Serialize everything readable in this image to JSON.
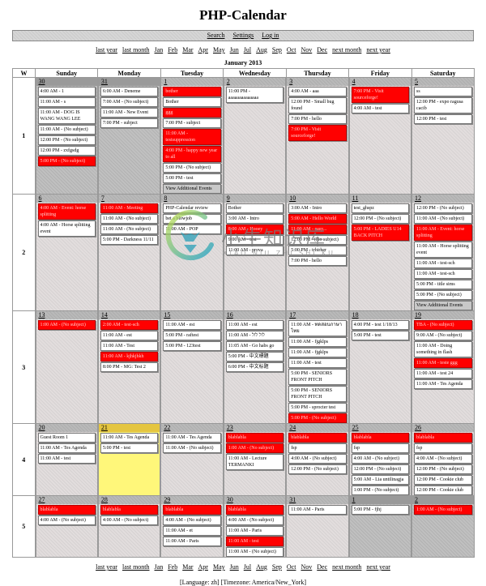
{
  "app": {
    "title": "PHP-Calendar"
  },
  "navbar": {
    "search": "Search",
    "settings": "Settings",
    "login": "Log in"
  },
  "month_nav": {
    "last_year": "last year",
    "last_month": "last month",
    "months": [
      "Jan",
      "Feb",
      "Mar",
      "Apr",
      "May",
      "Jun",
      "Jul",
      "Aug",
      "Sep",
      "Oct",
      "Nov",
      "Dec"
    ],
    "next_month": "next month",
    "next_year": "next year"
  },
  "calendar": {
    "caption": "January 2013",
    "week_header": "W",
    "weekdays": [
      "Sunday",
      "Monday",
      "Tuesday",
      "Wednesday",
      "Thursday",
      "Friday",
      "Saturday"
    ],
    "weeks": [
      {
        "number": "1",
        "days": [
          {
            "day": "30",
            "other": true,
            "events": [
              {
                "text": "4:00 AM - 1"
              },
              {
                "text": "11:00 AM - s"
              },
              {
                "text": "11:00 AM - DOG IS WANG WANG LEE"
              },
              {
                "text": "11:00 AM - (No subject)"
              },
              {
                "text": "12:00 PM - (No subject)"
              },
              {
                "text": "12:00 PM - zxfgsdg"
              },
              {
                "text": "5:00 PM - (No subject)",
                "highlight": true
              }
            ]
          },
          {
            "day": "31",
            "other": true,
            "events": [
              {
                "text": "6:00 AM - Deneme"
              },
              {
                "text": "7:00 AM - (No subject)"
              },
              {
                "text": "11:00 AM - New Event"
              },
              {
                "text": "7:00 PM - subject"
              }
            ]
          },
          {
            "day": "1",
            "events": [
              {
                "text": "bother",
                "highlight": true
              },
              {
                "text": "Bother"
              },
              {
                "text": "ggg",
                "highlight": true
              },
              {
                "text": "7:00 PM - subject"
              },
              {
                "text": "11:00 AM - testsuppression",
                "highlight": true
              },
              {
                "text": "4:00 PM - happy new year to all",
                "highlight": true
              },
              {
                "text": "5:00 PM - (No subject)"
              },
              {
                "text": "5:00 PM - test"
              },
              {
                "text": "View Additional Events",
                "more": true
              }
            ]
          },
          {
            "day": "2",
            "events": [
              {
                "text": "11:00 PM - aaaaaaaaaaaaaa"
              }
            ]
          },
          {
            "day": "3",
            "events": [
              {
                "text": "4:00 AM - aaa"
              },
              {
                "text": "12:00 PM - Small bug found"
              },
              {
                "text": "7:00 PM - hello"
              },
              {
                "text": "7:00 PM - Visit sourceforge!",
                "highlight": true
              }
            ]
          },
          {
            "day": "4",
            "events": [
              {
                "text": "7:00 PM - Visit sourceforge!",
                "highlight": true
              },
              {
                "text": "4:00 AM - test"
              }
            ]
          },
          {
            "day": "5",
            "events": [
              {
                "text": "ss"
              },
              {
                "text": "12:00 PM - expo ragusa cacib"
              },
              {
                "text": "12:00 PM - test"
              }
            ]
          }
        ]
      },
      {
        "number": "2",
        "days": [
          {
            "day": "6",
            "events": [
              {
                "text": "4:00 AM - Event: horse splitting",
                "highlight": true
              },
              {
                "text": "4:00 AM - Horse splitting event"
              }
            ]
          },
          {
            "day": "7",
            "events": [
              {
                "text": "11:00 AM - Meeting",
                "highlight": true
              },
              {
                "text": "11:00 AM - (No subject)"
              },
              {
                "text": "11:00 AM - (No subject)"
              },
              {
                "text": "5:00 PM - Darkness 11/11"
              }
            ]
          },
          {
            "day": "8",
            "events": [
              {
                "text": "PHP-Calendar review"
              },
              {
                "text": "bet a blowjob"
              },
              {
                "text": "11:00 AM - POP"
              }
            ]
          },
          {
            "day": "9",
            "events": [
              {
                "text": "Bother"
              },
              {
                "text": "3:00 AM - Intro"
              },
              {
                "text": "8:00 AM - Hooey",
                "highlight": true
              },
              {
                "text": "9:00 AM - test"
              },
              {
                "text": "11:00 AM - prova"
              }
            ]
          },
          {
            "day": "10",
            "events": [
              {
                "text": "3:00 AM - Intro"
              },
              {
                "text": "5:00 AM - Hello World",
                "highlight": true
              },
              {
                "text": "11:00 AM - easy...",
                "highlight": true
              },
              {
                "text": "12:00 PM - (No subject)"
              },
              {
                "text": "5:00 PM - trhtrher"
              },
              {
                "text": "7:00 PM - hello"
              }
            ]
          },
          {
            "day": "11",
            "events": [
              {
                "text": "test_ghspz"
              },
              {
                "text": "12:00 PM - (No subject)"
              },
              {
                "text": "5:00 PM - LADIES U14 BACK PITCH",
                "highlight": true
              }
            ]
          },
          {
            "day": "12",
            "events": [
              {
                "text": "12:00 PM - (No subject)"
              },
              {
                "text": "11:00 AM - (No subject)"
              },
              {
                "text": "11:00 AM - Event: horse splitting",
                "highlight": true
              },
              {
                "text": "11:00 AM - Horse splitting event"
              },
              {
                "text": "11:00 AM - test-sch"
              },
              {
                "text": "11:00 AM - test-sch"
              },
              {
                "text": "5:00 PM - title sims"
              },
              {
                "text": "5:00 PM - (No subject)"
              },
              {
                "text": "View Additional Events",
                "more": true
              }
            ]
          }
        ]
      },
      {
        "number": "3",
        "days": [
          {
            "day": "13",
            "events": [
              {
                "text": "1:00 AM - (No subject)",
                "highlight": true
              }
            ]
          },
          {
            "day": "14",
            "events": [
              {
                "text": "2:00 AM - test-sch",
                "highlight": true
              },
              {
                "text": "11:00 AM - est"
              },
              {
                "text": "11:00 AM - Test"
              },
              {
                "text": "11:00 AM - kjhkjhkh",
                "highlight": true
              },
              {
                "text": "8:00 PM - MG: Test 2"
              }
            ]
          },
          {
            "day": "15",
            "events": [
              {
                "text": "11:00 AM - est"
              },
              {
                "text": "5:00 PM - raftest"
              },
              {
                "text": "5:00 PM - 123test"
              }
            ]
          },
          {
            "day": "16",
            "events": [
              {
                "text": "11:00 AM - est"
              },
              {
                "text": "11:00 AM - לול לול"
              },
              {
                "text": "11:05 AM - Go habs go"
              },
              {
                "text": "5:00 PM - 中文標題"
              },
              {
                "text": "6:00 PM - 中文标题"
              }
            ]
          },
          {
            "day": "17",
            "events": [
              {
                "text": "11:00 AM - ทดสอบภาษาไทย"
              },
              {
                "text": "11:00 AM - fjgklps"
              },
              {
                "text": "11:00 AM - fjgklps"
              },
              {
                "text": "11:00 AM - test"
              },
              {
                "text": "5:00 PM - SENIORS FRONT PITCH"
              },
              {
                "text": "5:00 PM - SENIORS FRONT PITCH"
              },
              {
                "text": "5:00 PM - sprocter test"
              },
              {
                "text": "5:00 PM - (No subject)",
                "highlight": true
              }
            ]
          },
          {
            "day": "18",
            "events": [
              {
                "text": "4:00 PM - test 1/18/13"
              },
              {
                "text": "5:00 PM - test"
              }
            ]
          },
          {
            "day": "19",
            "events": [
              {
                "text": "TBA - (No subject)",
                "highlight": true
              },
              {
                "text": "9:00 AM - (No subject)"
              },
              {
                "text": "11:00 AM - Doing something in flash"
              },
              {
                "text": "11:00 AM - teste ggg",
                "highlight": true
              },
              {
                "text": "11:00 AM - test 24"
              },
              {
                "text": "11:00 AM - Tes Agenda"
              }
            ]
          }
        ]
      },
      {
        "number": "4",
        "days": [
          {
            "day": "20",
            "events": [
              {
                "text": "Guest Room 1"
              },
              {
                "text": "11:00 AM - Tes Agenda"
              },
              {
                "text": "11:00 AM - test"
              }
            ]
          },
          {
            "day": "21",
            "today": true,
            "events": [
              {
                "text": "11:00 AM - Tes Agenda"
              },
              {
                "text": "5:00 PM - test"
              }
            ]
          },
          {
            "day": "22",
            "events": [
              {
                "text": "11:00 AM - Tes Agenda"
              },
              {
                "text": "11:00 AM - (No subject)"
              }
            ]
          },
          {
            "day": "23",
            "events": [
              {
                "text": "blablabla",
                "highlight": true
              },
              {
                "text": "1:00 AM - (No subject)",
                "highlight": true
              },
              {
                "text": "11:00 AM - Lecture TERMANKI"
              }
            ]
          },
          {
            "day": "24",
            "events": [
              {
                "text": "blablabla",
                "highlight": true
              },
              {
                "text": "fsp"
              },
              {
                "text": "4:00 AM - (No subject)"
              },
              {
                "text": "12:00 PM - (No subject)"
              }
            ]
          },
          {
            "day": "25",
            "events": [
              {
                "text": "blablabla",
                "highlight": true
              },
              {
                "text": "fsp"
              },
              {
                "text": "4:00 AM - (No subject)"
              },
              {
                "text": "12:00 PM - (No subject)"
              },
              {
                "text": "5:00 AM - Lia untilinagja"
              },
              {
                "text": "1:00 PM - (No subject)"
              }
            ]
          },
          {
            "day": "26",
            "events": [
              {
                "text": "blablabla",
                "highlight": true
              },
              {
                "text": "fsp"
              },
              {
                "text": "4:00 AM - (No subject)"
              },
              {
                "text": "12:00 PM - (No subject)"
              },
              {
                "text": "12:00 PM - Cookie club"
              },
              {
                "text": "12:00 PM - Cookie club"
              }
            ]
          }
        ]
      },
      {
        "number": "5",
        "days": [
          {
            "day": "27",
            "events": [
              {
                "text": "blablabla",
                "highlight": true
              },
              {
                "text": "4:00 AM - (No subject)"
              }
            ]
          },
          {
            "day": "28",
            "events": [
              {
                "text": "blablabla",
                "highlight": true
              },
              {
                "text": "4:00 AM - (No subject)"
              }
            ]
          },
          {
            "day": "29",
            "events": [
              {
                "text": "blablabla",
                "highlight": true
              },
              {
                "text": "4:00 AM - (No subject)"
              },
              {
                "text": "11:00 AM - et"
              },
              {
                "text": "11:00 AM - Paris"
              }
            ]
          },
          {
            "day": "30",
            "events": [
              {
                "text": "blablabla",
                "highlight": true
              },
              {
                "text": "4:00 AM - (No subject)"
              },
              {
                "text": "11:00 AM - Paris"
              },
              {
                "text": "11:00 AM - test",
                "highlight": true
              },
              {
                "text": "11:00 AM - (No subject)"
              }
            ]
          },
          {
            "day": "31",
            "events": [
              {
                "text": "11:00 AM - Paris"
              }
            ]
          },
          {
            "day": "1",
            "other": true,
            "events": [
              {
                "text": "5:00 PM - fjhj"
              }
            ]
          },
          {
            "day": "2",
            "other": true,
            "events": [
              {
                "text": "1:00 AM - (No subject)",
                "highlight": true
              }
            ]
          }
        ]
      }
    ]
  },
  "footer": {
    "info": "[Language: zh] [Timezone: America/New_York]"
  },
  "watermark": {
    "text": "小牛知识库",
    "subtext": "XIAO NIU ZHI SHI KU"
  },
  "colors": {
    "highlight": "#ff0000",
    "today": "#fff77a",
    "navbar": "#d6d6d6"
  }
}
